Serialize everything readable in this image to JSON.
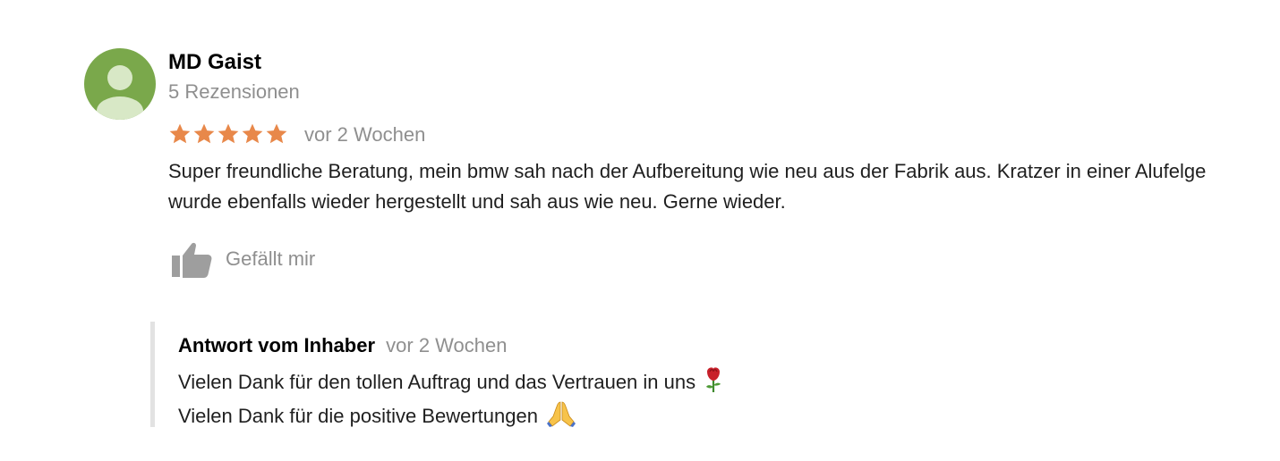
{
  "reviewer": {
    "name": "MD Gaist",
    "review_count": "5 Rezensionen",
    "avatar_icon": "default-user-avatar-icon",
    "avatar_color": "#7aa84b"
  },
  "review": {
    "rating": 5,
    "max_rating": 5,
    "star_color": "#e8884a",
    "date": "vor 2 Wochen",
    "text": "Super freundliche Beratung, mein bmw sah nach der Aufbereitung wie neu aus der Fabrik aus. Kratzer in einer Alufelge wurde ebenfalls wieder hergestellt und sah aus wie neu. Gerne wieder."
  },
  "actions": {
    "like_label": "Gefällt mir",
    "like_icon": "thumbs-up-icon"
  },
  "owner_reply": {
    "author": "Antwort vom Inhaber",
    "date": "vor 2 Wochen",
    "line1": "Vielen Dank für den tollen Auftrag und das Vertrauen in uns",
    "line1_emoji": "rose-emoji",
    "line2": "Vielen Dank für die positive Bewertungen",
    "line2_emoji": "folded-hands-emoji"
  }
}
